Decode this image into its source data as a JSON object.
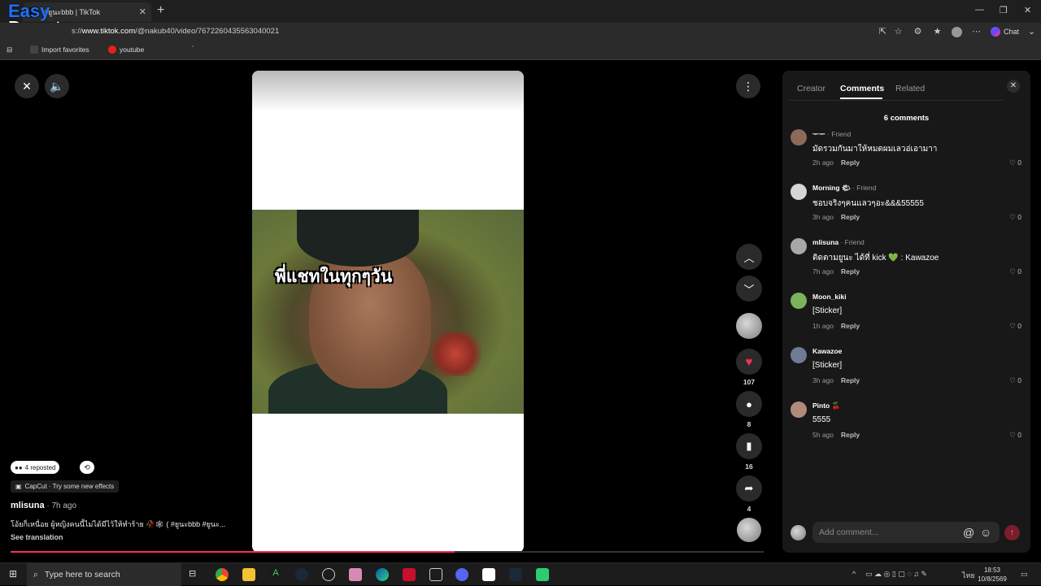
{
  "browser": {
    "tab_title": "#ยูนะbbb | TikTok",
    "url_prefix": "s://",
    "url_domain": "www.tiktok.com",
    "url_path": "/@nakub40/video/7672260435563040021",
    "chat_label": "Chat",
    "bookmarks": [
      {
        "label": "Import favorites",
        "icon": "folder-icon"
      },
      {
        "label": "youtube",
        "icon": "youtube-icon"
      }
    ]
  },
  "watermark": {
    "line1": "Easy",
    "line2": "Donate"
  },
  "video": {
    "caption": "พี่แชทในทุกๆวัน",
    "progress_fraction": 0.59
  },
  "actions": {
    "likes": "107",
    "comments": "8",
    "saves": "16",
    "shares": "4"
  },
  "post": {
    "repost_text": "4 reposted",
    "effect_text": "CapCut · Try some new effects",
    "author": "mlisuna",
    "time": " · 7h ago",
    "description": "โอ้ยก็เหนื่อย ผู้หญิงคนนี้ไม่ได้มีไว้ให้ทำร้าย 🥀🕸 ( #ยูนะbbb #ยูนะ...",
    "see_translation": "See translation"
  },
  "panel": {
    "tabs": [
      "Creator",
      "Comments",
      "Related"
    ],
    "active_tab": "Comments",
    "count_text": "6 comments",
    "comments": [
      {
        "name": "ᅮᅮ",
        "friend": " · Friend",
        "text": "มัดรวมกันมาให้หมดผมเลวอ่เอามาา",
        "time": "2h ago",
        "reply": "Reply",
        "likes": "0",
        "avatar_color": "#8b6a5a"
      },
      {
        "name": "Morning 🌤",
        "friend": " · Friend",
        "text": "ชอบจริงๆคนแลวๆอะ&&&55555",
        "time": "3h ago",
        "reply": "Reply",
        "likes": "0",
        "avatar_color": "#d5d5d5"
      },
      {
        "name": "mlisuna",
        "friend": " · Friend",
        "text": "ติดตามยูนะ ได้ที่ kick 💚 : Kawazoe",
        "time": "7h ago",
        "reply": "Reply",
        "likes": "0",
        "avatar_color": "#a8a8a8"
      },
      {
        "name": "Moon_kiki",
        "friend": "",
        "text": "[Sticker]",
        "time": "1h ago",
        "reply": "Reply",
        "likes": "0",
        "avatar_color": "#7bb35a"
      },
      {
        "name": "Kawazoe",
        "friend": "",
        "text": "[Sticker]",
        "time": "3h ago",
        "reply": "Reply",
        "likes": "0",
        "avatar_color": "#6f7a94"
      },
      {
        "name": "Pinto 🍒",
        "friend": "",
        "text": "5555",
        "time": "5h ago",
        "reply": "Reply",
        "likes": "0",
        "avatar_color": "#b08a7a"
      }
    ],
    "add_comment_placeholder": "Add comment..."
  },
  "taskbar": {
    "search_placeholder": "Type here to search",
    "lang": "ไทย",
    "time": "18:53",
    "date": "10/8/2569"
  },
  "colors": {
    "accent": "#fe2c55",
    "panel_bg": "#181818"
  }
}
